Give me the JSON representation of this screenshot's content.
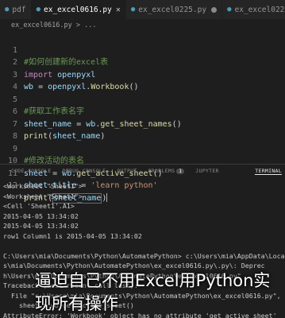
{
  "tabs": [
    {
      "label": "pdf"
    },
    {
      "label": "ex_excel0616.py"
    },
    {
      "label": "ex_excel0225.py"
    },
    {
      "label": "ex_excel0225_1.py"
    },
    {
      "label": "ex_exce"
    }
  ],
  "breadcrumb": "ex_excel0616.py > ...",
  "code_lines": [
    {
      "num": "1",
      "text": "#如何创建新的excel表",
      "kind": "comment"
    },
    {
      "num": "2",
      "text": "import openpyxl",
      "kind": "import"
    },
    {
      "num": "3",
      "text": "wb = openpyxl.Workbook()",
      "kind": "assign"
    },
    {
      "num": "4",
      "text": "",
      "kind": "blank"
    },
    {
      "num": "5",
      "text": "#获取工作表名字",
      "kind": "comment"
    },
    {
      "num": "6",
      "text": "sheet_name = wb.get_sheet_names()",
      "kind": "assign"
    },
    {
      "num": "7",
      "text": "print(sheet_name)",
      "kind": "print"
    },
    {
      "num": "8",
      "text": "",
      "kind": "blank"
    },
    {
      "num": "9",
      "text": "#修改活动的表名",
      "kind": "comment"
    },
    {
      "num": "10",
      "text": "sheet = wb.get_active_sheet()",
      "kind": "assign"
    },
    {
      "num": "11",
      "text": "sheet.title = 'learn python'",
      "kind": "str"
    },
    {
      "num": "12",
      "text": "print(sheet_name)",
      "kind": "print-cursor"
    }
  ],
  "panel_tabs": [
    {
      "label": "CODE CONSOLE"
    },
    {
      "label": "DEBUG CONSOLE"
    },
    {
      "label": "OUTPUT"
    },
    {
      "label": "PROBLEMS",
      "badge": "1"
    },
    {
      "label": "JUPYTER"
    },
    {
      "label": "TERMINAL",
      "active": true
    }
  ],
  "terminal_lines": [
    "<Worksheet \"Sheet1\">",
    "<Worksheet \"Sheet1\">",
    "<Cell 'Sheet1'.A1>",
    "2015-04-05 13:34:02",
    "2015-04-05 13:34:02",
    "row1 Column1 is 2015-04-05 13:34:02",
    "",
    "C:\\Users\\mia\\Documents\\Python\\AutomatePython> c:\\Users\\mia\\AppData\\Local",
    "s\\mia\\Documents\\Python\\AutomatePython\\ex_excel0616.py\\.py\\: Deprec",
    "h\\Users\\mia\\Documents\\Python\\AutomatePython\\ex_excel0616.py\"",
    "Traceback (most recent call last):",
    "  File \"c:\\Users\\mia\\Documents\\Python\\AutomatePython\\ex_excel0616.py\",",
    "    sheet = wb.get_active_sheet()",
    "AttributeError: 'Workbook' object has no attribute 'get_active_sheet'"
  ],
  "overlay_caption": "逼迫自己不用Excel用Python实现所有操作"
}
